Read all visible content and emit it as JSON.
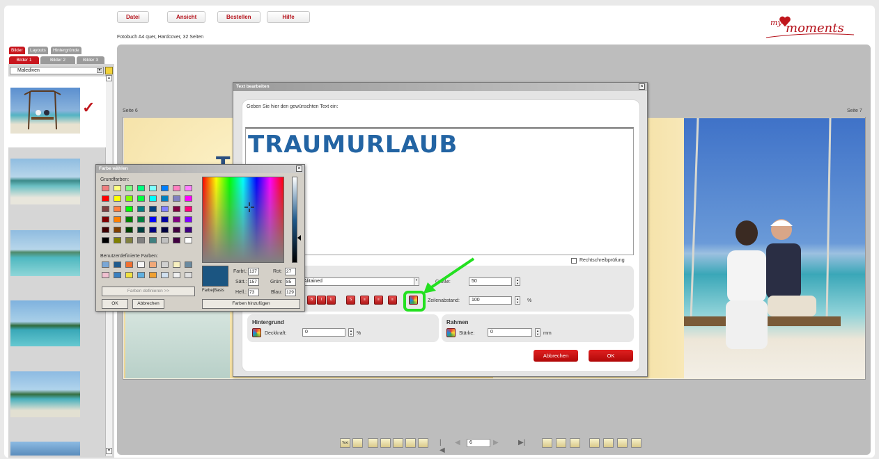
{
  "menu": {
    "items": [
      "Datei",
      "Ansicht",
      "Bestellen",
      "Hilfe"
    ]
  },
  "logo": {
    "prefix": "my",
    "text": "moments"
  },
  "subtitle": "Fotobuch A4 quer, Hardcover, 32 Seiten",
  "left_panel": {
    "tabs": [
      "Bilder",
      "Layouts",
      "Hintergründe"
    ],
    "subtabs": [
      "Bilder 1",
      "Bilder 2",
      "Bilder 3"
    ],
    "album_select": "Malediven",
    "selected_check": "✓"
  },
  "pages": {
    "left_label": "Seite 6",
    "right_label": "Seite 7"
  },
  "text_dialog": {
    "title": "Text bearbeiten",
    "prompt": "Geben Sie hier den gewünschten Text ein:",
    "text_content": "TRAUMURLAUB",
    "spellcheck_label": "Rechtschreibprüfung",
    "font_value": "Alitained",
    "size_label": "Größe:",
    "size_value": "50",
    "line_spacing_label": "Zeilenabstand:",
    "line_spacing_value": "100",
    "percent": "%",
    "format_buttons": [
      "B",
      "I",
      "U",
      "S",
      "≡",
      "≡",
      "≡",
      "Pos"
    ],
    "background": {
      "heading": "Hintergrund",
      "opacity_label": "Deckkraft:",
      "opacity_value": "0",
      "unit": "%"
    },
    "frame": {
      "heading": "Rahmen",
      "strength_label": "Stärke:",
      "strength_value": "0",
      "unit": "mm"
    },
    "cancel_label": "Abbrechen",
    "ok_label": "OK"
  },
  "color_dialog": {
    "title": "Farbe wählen",
    "basic_label": "Grundfarben:",
    "custom_label": "Benutzerdefinierte Farben:",
    "define_button": "Farben definieren >>",
    "ok_label": "OK",
    "cancel_label": "Abbrechen",
    "color_solid_label": "Farbe|Basis",
    "add_button": "Farben hinzufügen",
    "fields": {
      "hue_label": "Farbt.:",
      "hue": "137",
      "sat_label": "Sätt.:",
      "sat": "157",
      "lum_label": "Hell.:",
      "lum": "73",
      "red_label": "Rot:",
      "red": "27",
      "green_label": "Grün:",
      "green": "85",
      "blue_label": "Blau:",
      "blue": "129"
    },
    "current_color": "#1b5581",
    "basic_colors": [
      "#f08080",
      "#ffff80",
      "#80ff80",
      "#00ff80",
      "#80ffff",
      "#0080ff",
      "#ff80c0",
      "#ff80ff",
      "#ff0000",
      "#ffff00",
      "#80ff00",
      "#00ff40",
      "#00ffff",
      "#0080c0",
      "#8080c0",
      "#ff00ff",
      "#804040",
      "#ff8040",
      "#00ff00",
      "#008080",
      "#004080",
      "#8080ff",
      "#800040",
      "#ff0080",
      "#800000",
      "#ff8000",
      "#008000",
      "#008040",
      "#0000ff",
      "#0000a0",
      "#800080",
      "#8000ff",
      "#400000",
      "#804000",
      "#004000",
      "#004040",
      "#000080",
      "#000040",
      "#400040",
      "#400080",
      "#000000",
      "#808000",
      "#808040",
      "#808080",
      "#408080",
      "#c0c0c0",
      "#400040",
      "#ffffff"
    ],
    "custom_colors": [
      "#7aa7d6",
      "#1f5a8c",
      "#f07030",
      "#f8f8f8",
      "#f0a878",
      "#d0d0d0",
      "#f8f0c0",
      "#6a8aa0",
      "#f0c0d0",
      "#3a80c0",
      "#f0e040",
      "#60b0e0",
      "#f0a030",
      "#d0e0f0",
      "#f0f0f0",
      "#e0e0e0"
    ]
  },
  "navigator": {
    "page_value": "6"
  }
}
